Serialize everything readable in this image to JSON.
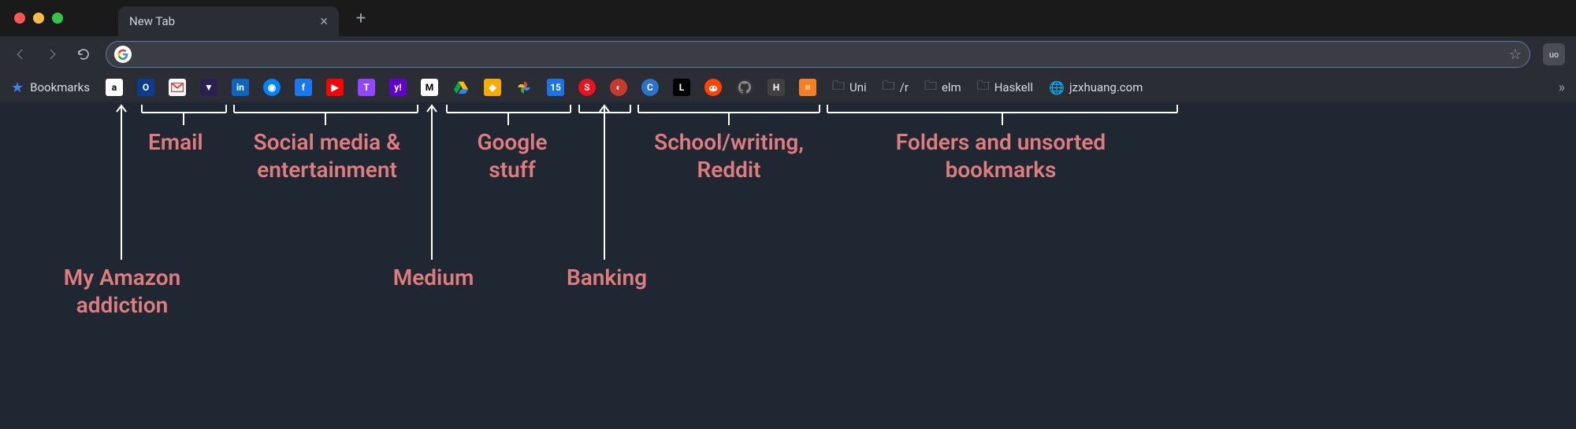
{
  "tab": {
    "title": "New Tab"
  },
  "bookmarks_label": "Bookmarks",
  "icons": {
    "amazon": "a",
    "outlook": "O",
    "gmail": "M",
    "protonmail": "▼",
    "linkedin": "in",
    "messenger": "◉",
    "facebook": "f",
    "youtube": "▶",
    "twitch": "T",
    "yahoo": "y!",
    "medium": "M",
    "drive": "▲",
    "keep": "◆",
    "photos": "✦",
    "calendar": "15",
    "scotia": "S",
    "spin": "◐",
    "coursera": "C",
    "learn": "L",
    "reddit": "●",
    "github": "",
    "hn": "H",
    "stackoverflow": "≡"
  },
  "folders": [
    "Uni",
    "/r",
    "elm",
    "Haskell"
  ],
  "link": {
    "label": "jzxhuang.com"
  },
  "annotations": {
    "amazon": "My Amazon\naddiction",
    "email": "Email",
    "social": "Social media &\nentertainment",
    "medium": "Medium",
    "google": "Google\nstuff",
    "banking": "Banking",
    "school": "School/writing,\nReddit",
    "folders": "Folders and unsorted\nbookmarks"
  },
  "ext": {
    "label": "uo"
  },
  "overflow": "»"
}
